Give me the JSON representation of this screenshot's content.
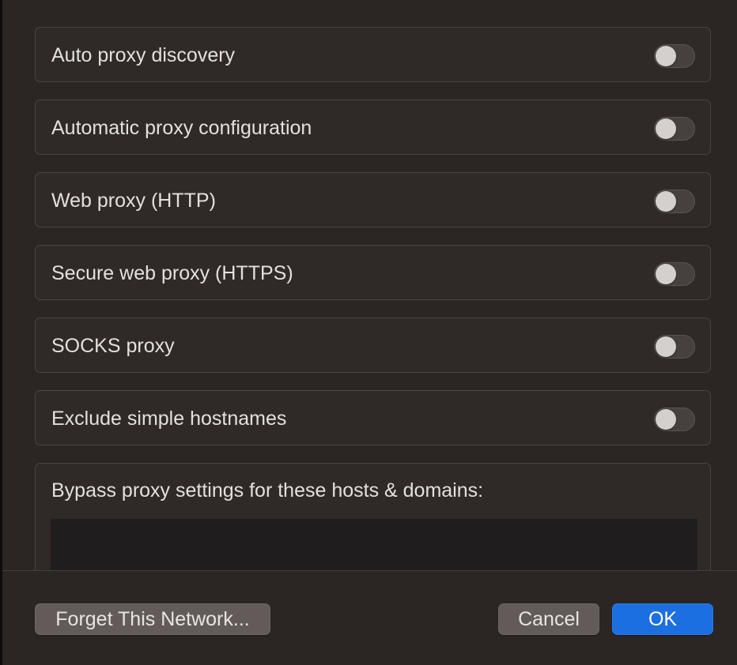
{
  "proxy_options": [
    {
      "label": "Auto proxy discovery",
      "enabled": false
    },
    {
      "label": "Automatic proxy configuration",
      "enabled": false
    },
    {
      "label": "Web proxy (HTTP)",
      "enabled": false
    },
    {
      "label": "Secure web proxy (HTTPS)",
      "enabled": false
    },
    {
      "label": "SOCKS proxy",
      "enabled": false
    },
    {
      "label": "Exclude simple hostnames",
      "enabled": false
    }
  ],
  "bypass": {
    "label": "Bypass proxy settings for these hosts & domains:",
    "value": ""
  },
  "footer": {
    "forget_label": "Forget This Network...",
    "cancel_label": "Cancel",
    "ok_label": "OK"
  },
  "colors": {
    "background": "#2b2523",
    "accent": "#1c6fe0",
    "toggle_off": "#46403e"
  },
  "icons": [
    "toggle-switch"
  ]
}
